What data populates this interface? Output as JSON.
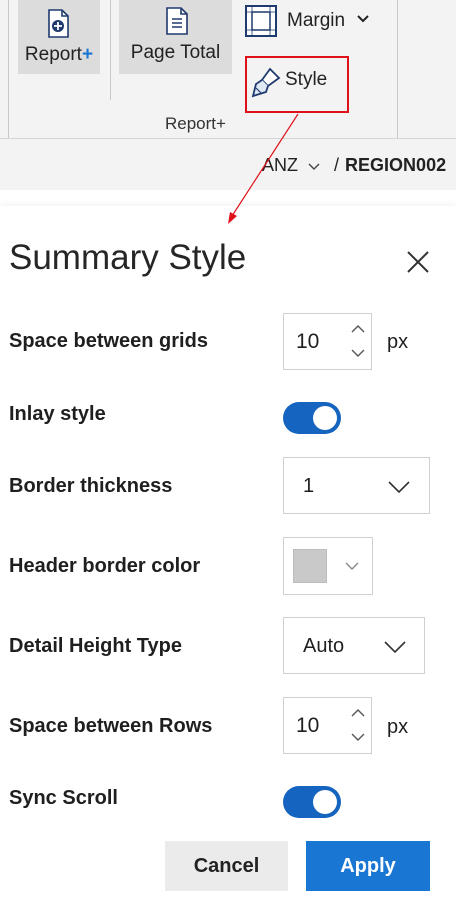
{
  "ribbon": {
    "report_label": "Report",
    "report_plus": "+",
    "page_total_label": "Page Total",
    "margin_label": "Margin",
    "style_label": "Style",
    "group_label": "Report+"
  },
  "breadcrumb": {
    "parent": "ANZ",
    "separator": "/",
    "current": "REGION002"
  },
  "panel": {
    "title": "Summary Style",
    "rows": {
      "space_between_grids": {
        "label": "Space between grids",
        "value": "10",
        "unit": "px"
      },
      "inlay_style": {
        "label": "Inlay style",
        "on": true
      },
      "border_thickness": {
        "label": "Border thickness",
        "value": "1"
      },
      "header_border_color": {
        "label": "Header border color",
        "color": "#c9c9c9"
      },
      "detail_height_type": {
        "label": "Detail Height Type",
        "value": "Auto"
      },
      "space_between_rows": {
        "label": "Space between Rows",
        "value": "10",
        "unit": "px"
      },
      "sync_scroll": {
        "label": "Sync Scroll",
        "on": true
      }
    },
    "cancel_label": "Cancel",
    "apply_label": "Apply"
  },
  "colors": {
    "accent": "#1976d2",
    "toggle_on": "#1565c0",
    "highlight_box": "#e0101a"
  }
}
